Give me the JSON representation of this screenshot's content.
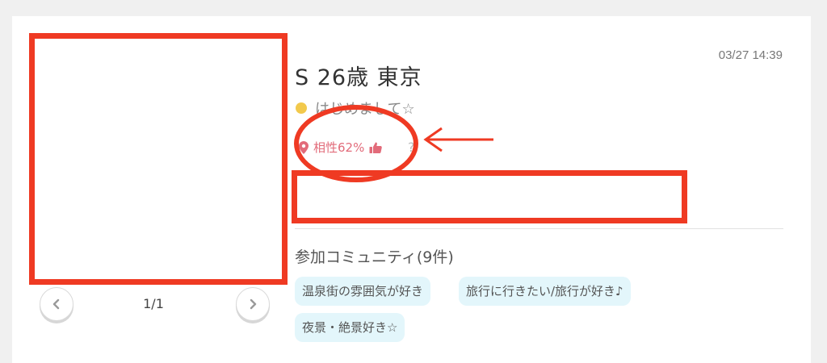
{
  "profile": {
    "timestamp": "03/27 14:39",
    "name_line": "S 26歳 東京",
    "status_message": "はじめまして☆",
    "compatibility": "相性62%",
    "help_symbol": "?"
  },
  "photo": {
    "pager": "1/1"
  },
  "community": {
    "title": "参加コミュニティ(9件)",
    "tags": [
      "温泉街の雰囲気が好き",
      "旅行に行きたい/旅行が好き♪",
      "夜景・絶景好き☆"
    ]
  },
  "colors": {
    "annotation_red": "#ef3a23",
    "status_dot": "#f2c94c",
    "compat_pink": "#e26b7a",
    "tag_bg": "#e3f6fb"
  },
  "icons": {
    "status": "status-dot-icon",
    "compat_pin": "location-pin-icon",
    "compat_thumb": "thumbs-up-icon",
    "prev": "chevron-left-icon",
    "next": "chevron-right-icon"
  }
}
